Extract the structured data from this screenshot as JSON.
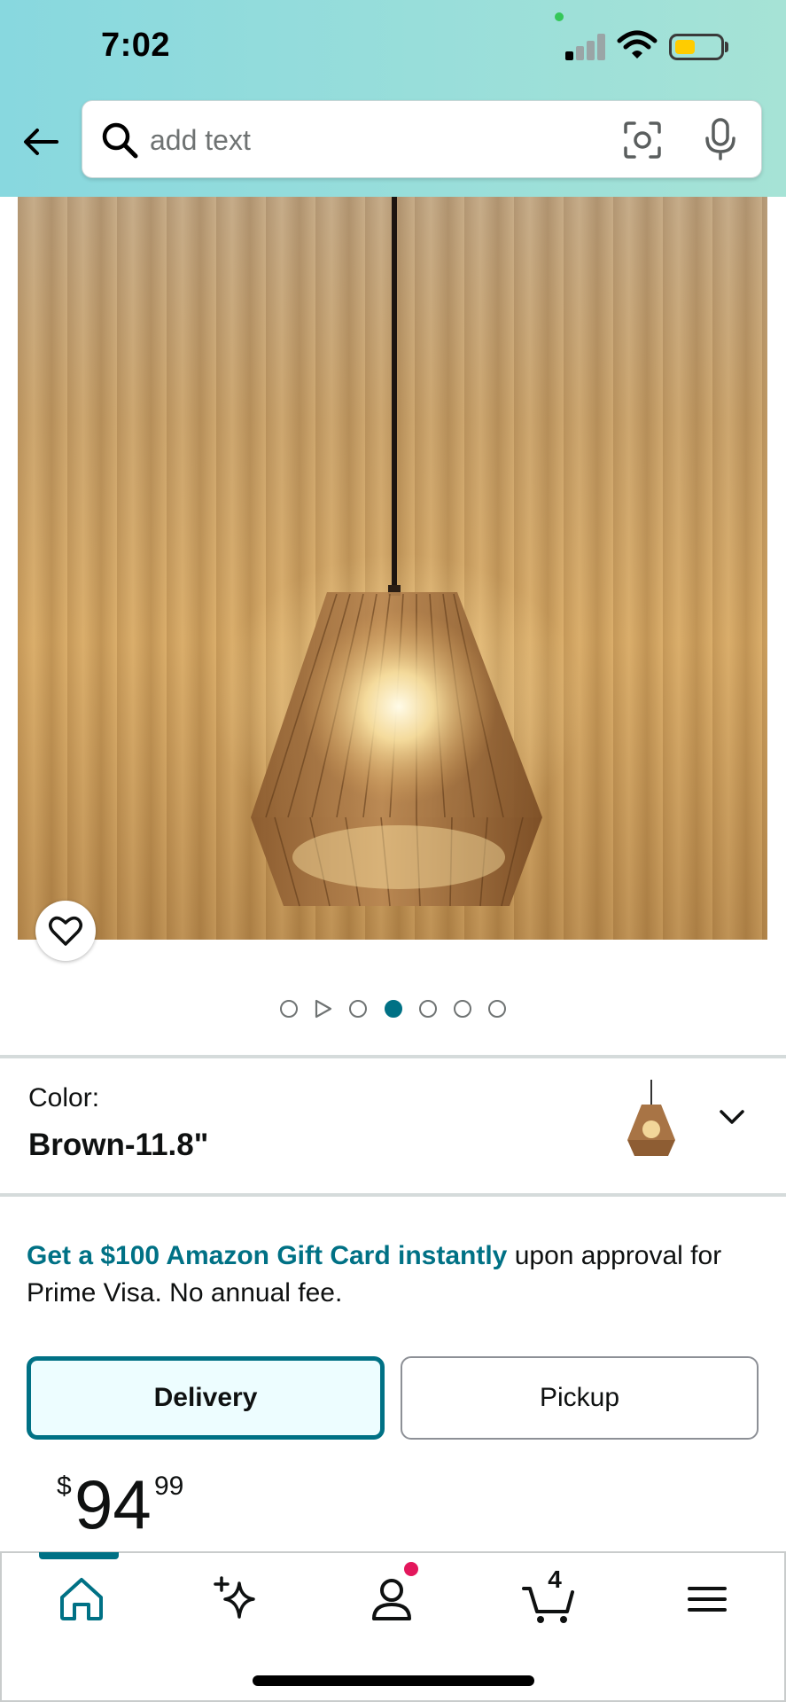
{
  "status_bar": {
    "time": "7:02"
  },
  "search": {
    "placeholder": "add text"
  },
  "product": {
    "carousel": {
      "total_slides": 7,
      "active_index": 3,
      "video_slide_index": 1
    },
    "color": {
      "label": "Color:",
      "value": "Brown-11.8\""
    },
    "promo": {
      "link_text": "Get a $100 Amazon Gift Card instantly",
      "rest_text": " upon approval for Prime Visa. No annual fee."
    },
    "fulfillment": {
      "delivery_label": "Delivery",
      "pickup_label": "Pickup",
      "selected": "Delivery"
    },
    "price": {
      "symbol": "$",
      "whole": "94",
      "fraction": "99"
    }
  },
  "bottom_nav": {
    "items": [
      "home-icon",
      "sparkle-icon",
      "account-icon",
      "cart-icon",
      "menu-icon"
    ],
    "active": "home-icon",
    "cart_count": "4"
  },
  "colors": {
    "accent": "#007185",
    "notification": "#e3175c",
    "header_start": "#88d8df",
    "header_end": "#a6e3d6"
  }
}
